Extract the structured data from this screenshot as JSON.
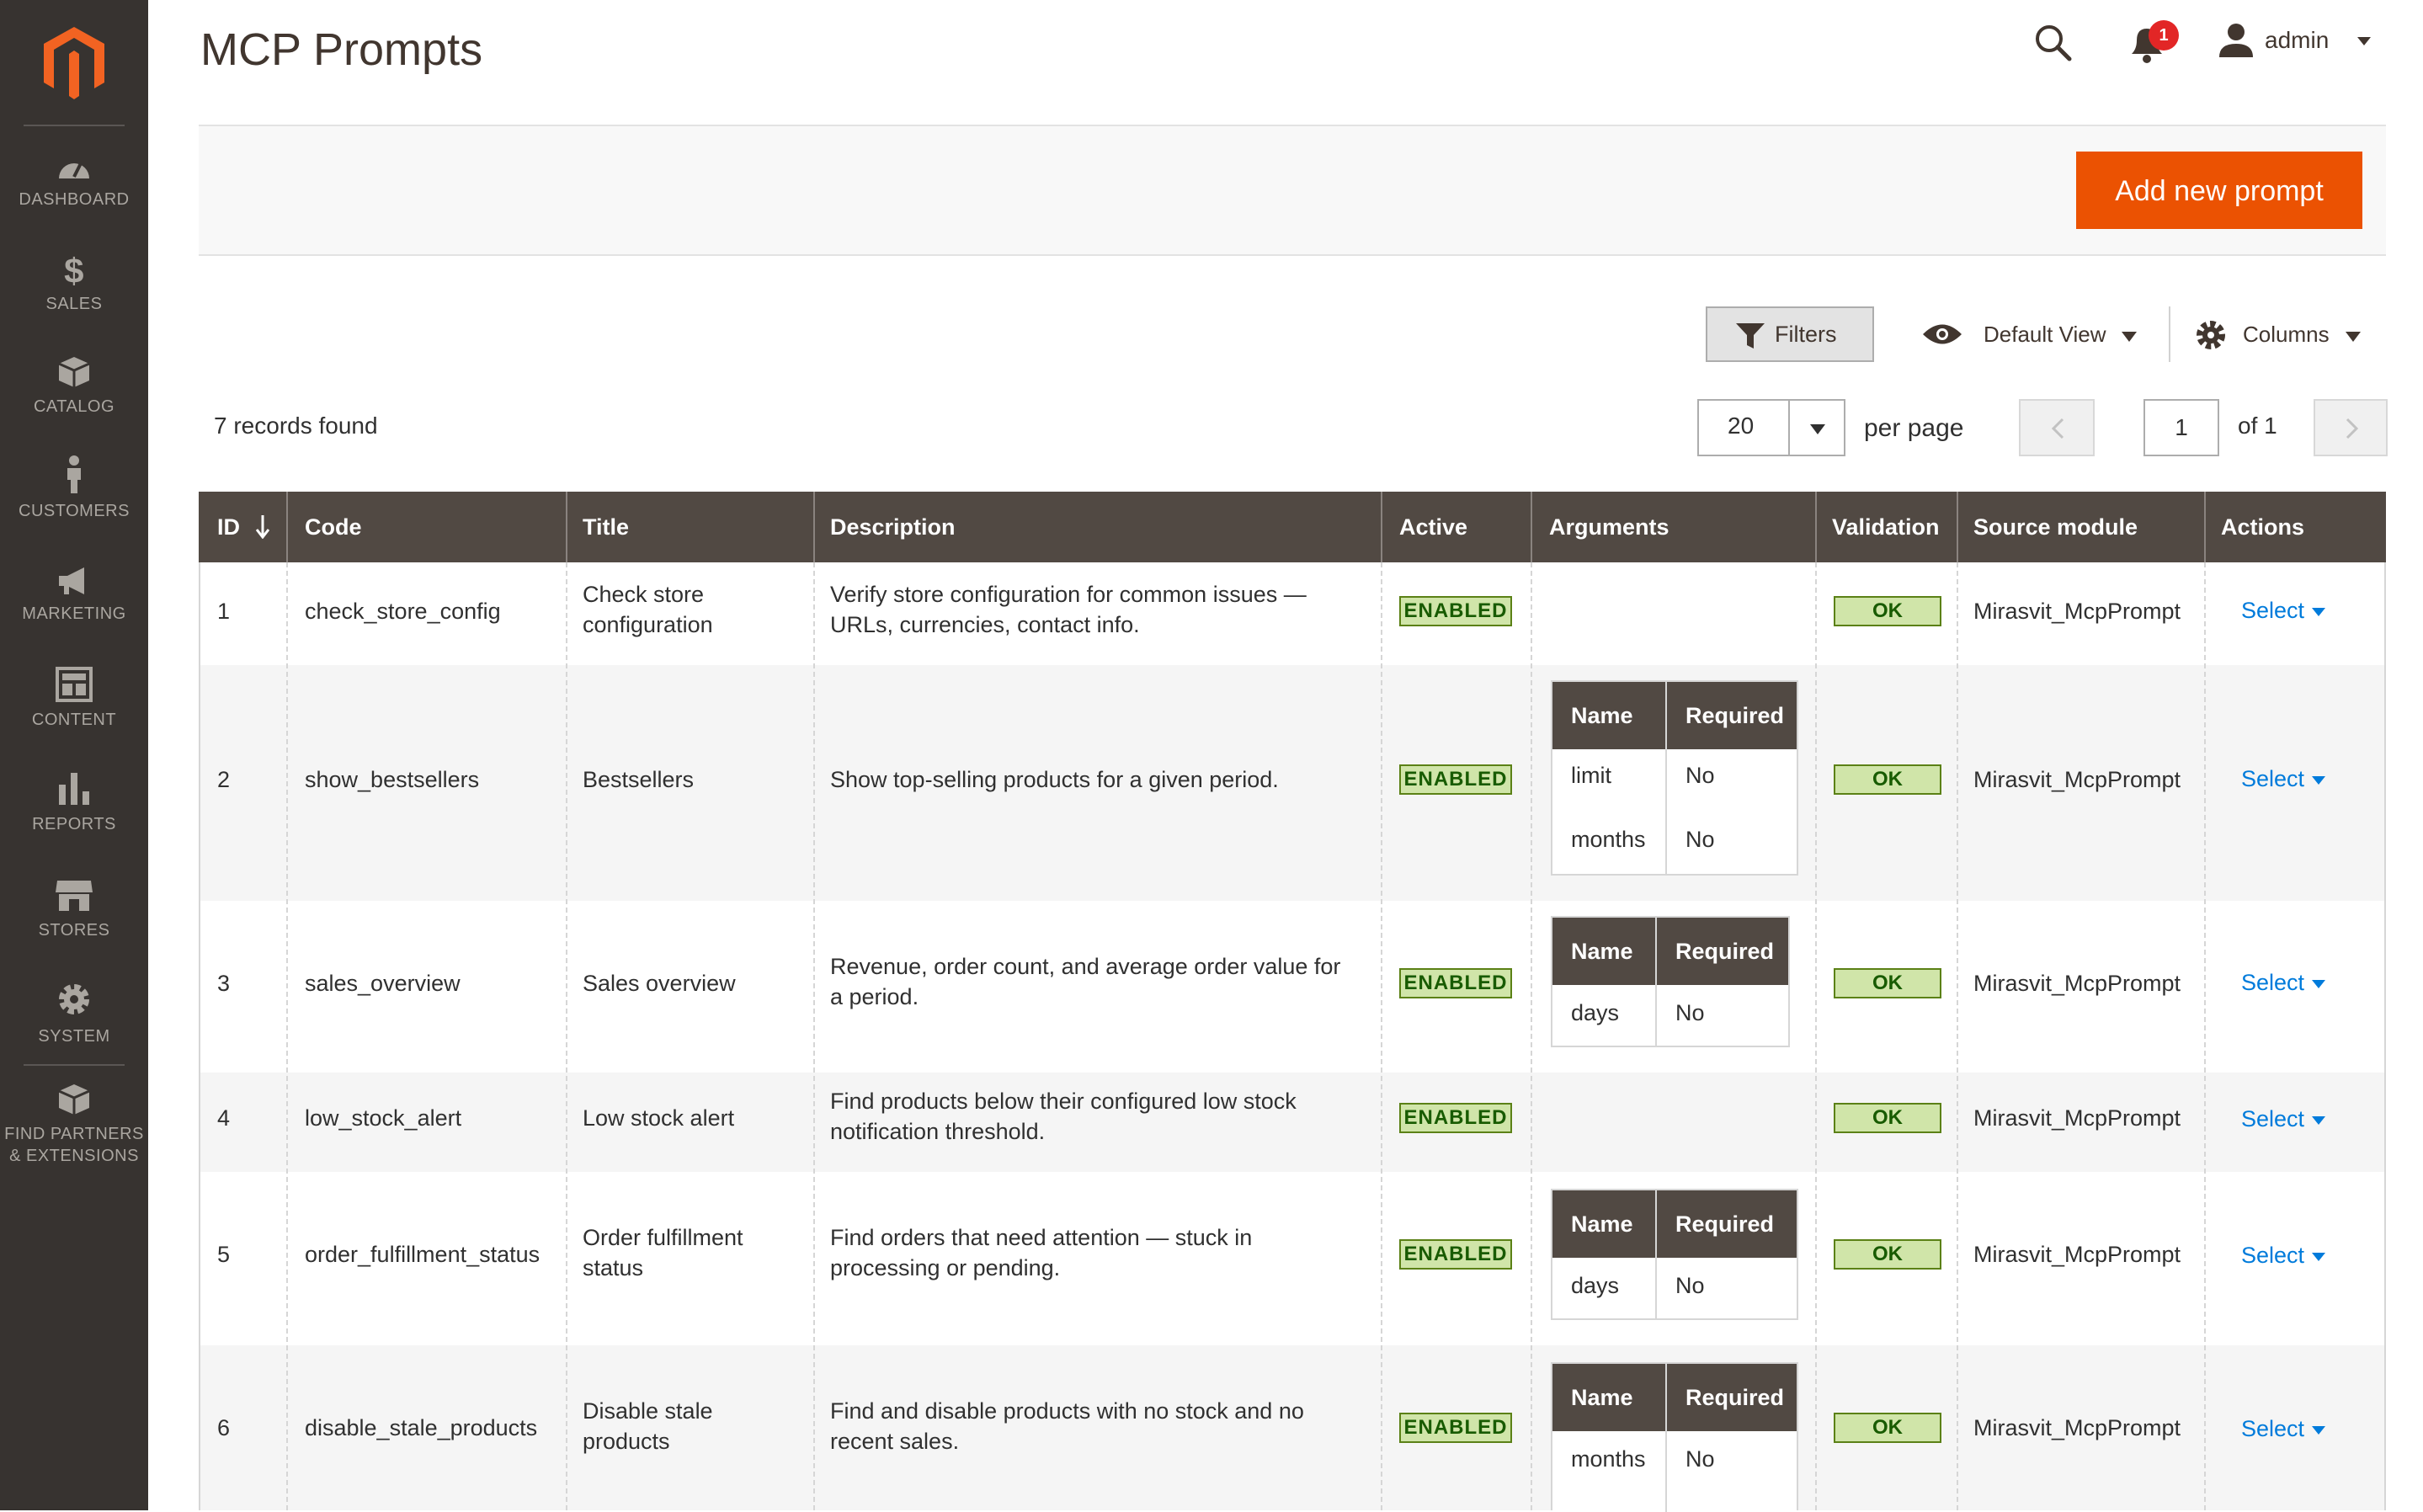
{
  "sidebar": {
    "items": [
      {
        "label": "DASHBOARD",
        "icon": "dashboard-icon"
      },
      {
        "label": "SALES",
        "icon": "dollar-icon"
      },
      {
        "label": "CATALOG",
        "icon": "box-icon"
      },
      {
        "label": "CUSTOMERS",
        "icon": "person-icon"
      },
      {
        "label": "MARKETING",
        "icon": "megaphone-icon"
      },
      {
        "label": "CONTENT",
        "icon": "layout-icon"
      },
      {
        "label": "REPORTS",
        "icon": "bar-chart-icon"
      },
      {
        "label": "STORES",
        "icon": "storefront-icon"
      },
      {
        "label": "SYSTEM",
        "icon": "gear-icon"
      }
    ],
    "partners_line1": "FIND PARTNERS",
    "partners_line2": "& EXTENSIONS"
  },
  "header": {
    "title": "MCP Prompts",
    "notification_count": "1",
    "user": "admin"
  },
  "actions": {
    "add_new": "Add new prompt"
  },
  "toolbar": {
    "filters": "Filters",
    "view": "Default View",
    "columns": "Columns",
    "records_found": "7 records found",
    "per_page_value": "20",
    "per_page_label": "per page",
    "page_current": "1",
    "page_of": "of 1"
  },
  "grid": {
    "columns": [
      "ID",
      "Code",
      "Title",
      "Description",
      "Active",
      "Arguments",
      "Validation",
      "Source module",
      "Actions"
    ],
    "arg_columns": [
      "Name",
      "Required"
    ],
    "rows": [
      {
        "id": "1",
        "code": "check_store_config",
        "title": [
          "Check store",
          "configuration"
        ],
        "description": [
          "Verify store configuration for common issues —",
          "URLs, currencies, contact info."
        ],
        "active": "ENABLED",
        "args": [],
        "validation": "OK",
        "module": "Mirasvit_McpPrompt",
        "action": "Select"
      },
      {
        "id": "2",
        "code": "show_bestsellers",
        "title": [
          "Bestsellers"
        ],
        "description": [
          "Show top-selling products for a given period."
        ],
        "active": "ENABLED",
        "args": [
          {
            "name": "limit",
            "required": "No"
          },
          {
            "name": "months",
            "required": "No"
          }
        ],
        "validation": "OK",
        "module": "Mirasvit_McpPrompt",
        "action": "Select"
      },
      {
        "id": "3",
        "code": "sales_overview",
        "title": [
          "Sales overview"
        ],
        "description": [
          "Revenue, order count, and average order value for",
          "a period."
        ],
        "active": "ENABLED",
        "args": [
          {
            "name": "days",
            "required": "No"
          }
        ],
        "validation": "OK",
        "module": "Mirasvit_McpPrompt",
        "action": "Select"
      },
      {
        "id": "4",
        "code": "low_stock_alert",
        "title": [
          "Low stock alert"
        ],
        "description": [
          "Find products below their configured low stock",
          "notification threshold."
        ],
        "active": "ENABLED",
        "args": [],
        "validation": "OK",
        "module": "Mirasvit_McpPrompt",
        "action": "Select"
      },
      {
        "id": "5",
        "code": "order_fulfillment_status",
        "title": [
          "Order fulfillment",
          "status"
        ],
        "description": [
          "Find orders that need attention — stuck in",
          "processing or pending."
        ],
        "active": "ENABLED",
        "args": [
          {
            "name": "days",
            "required": "No"
          }
        ],
        "validation": "OK",
        "module": "Mirasvit_McpPrompt",
        "action": "Select"
      },
      {
        "id": "6",
        "code": "disable_stale_products",
        "title": [
          "Disable stale",
          "products"
        ],
        "description": [
          "Find and disable products with no stock and no",
          "recent sales."
        ],
        "active": "ENABLED",
        "args": [
          {
            "name": "months",
            "required": "No"
          }
        ],
        "validation": "OK",
        "module": "Mirasvit_McpPrompt",
        "action": "Select"
      }
    ]
  }
}
